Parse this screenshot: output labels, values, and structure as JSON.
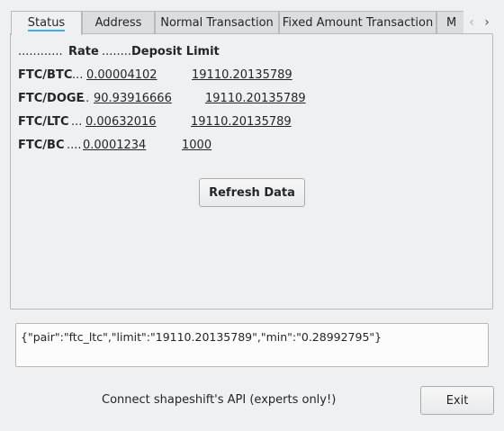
{
  "tabs": [
    {
      "label": "Status",
      "active": true
    },
    {
      "label": "Address",
      "active": false
    },
    {
      "label": "Normal Transaction",
      "active": false
    },
    {
      "label": "Fixed Amount Transaction",
      "active": false
    },
    {
      "label": "M",
      "active": false
    }
  ],
  "tab_scroll": {
    "left_icon": "chevron-left-icon",
    "right_icon": "chevron-right-icon"
  },
  "status": {
    "header": {
      "dots1": "............",
      "rate": "Rate",
      "dots2": "........",
      "limit": "Deposit Limit"
    },
    "rows": [
      {
        "pair": "FTC/BTC",
        "dots": "...",
        "rate": "0.00004102",
        "limit": "19110.20135789"
      },
      {
        "pair": "FTC/DOGE",
        "dots": "..",
        "rate": "90.93916666",
        "limit": "19110.20135789"
      },
      {
        "pair": "FTC/LTC",
        "dots": "...",
        "rate": "0.00632016",
        "limit": "19110.20135789"
      },
      {
        "pair": "FTC/BC",
        "dots": "....",
        "rate": "0.0001234",
        "limit": "1000"
      }
    ],
    "refresh_label": "Refresh Data"
  },
  "output_text": "{\"pair\":\"ftc_ltc\",\"limit\":\"19110.20135789\",\"min\":\"0.28992795\"}",
  "footer": {
    "api_label": "Connect  shapeshift's API (experts only!)",
    "exit_label": "Exit"
  },
  "colors": {
    "accent": "#3daee9",
    "background": "#eff0f1"
  }
}
